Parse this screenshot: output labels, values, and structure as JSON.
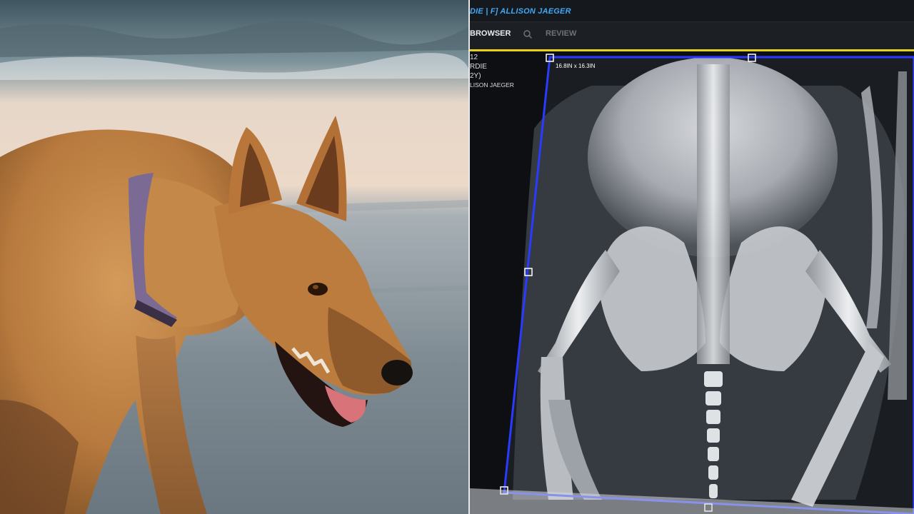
{
  "viewer": {
    "title": "DIE | F] ALLISON JAEGER",
    "tabs": [
      {
        "label": "BROWSER",
        "active": true
      },
      {
        "label": "REVIEW",
        "active": false
      }
    ],
    "patient": {
      "id": "12",
      "name": "RDIE",
      "age": "2Y)",
      "owner": "LISON JAEGER"
    },
    "image_dimensions": "16.8IN x 16.3IN"
  },
  "colors": {
    "title_text": "#3fa9f5",
    "active_tab_line": "#e6d21c",
    "selection_box": "#2a3bff",
    "xray_bg": "#0d0f12"
  },
  "icons": {
    "search": "search-icon"
  }
}
